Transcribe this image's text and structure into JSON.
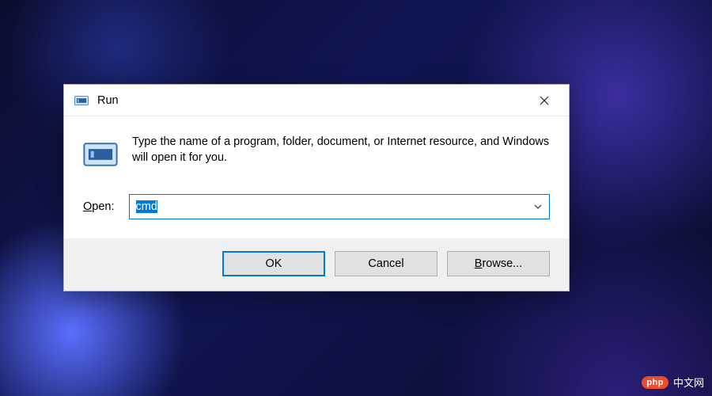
{
  "dialog": {
    "title": "Run",
    "description": "Type the name of a program, folder, document, or Internet resource, and Windows will open it for you.",
    "open_label_pre": "O",
    "open_label_post": "pen:",
    "input_value": "cmd",
    "buttons": {
      "ok": "OK",
      "cancel": "Cancel",
      "browse_pre": "B",
      "browse_post": "rowse..."
    }
  },
  "watermark": {
    "badge": "php",
    "text": "中文网"
  }
}
